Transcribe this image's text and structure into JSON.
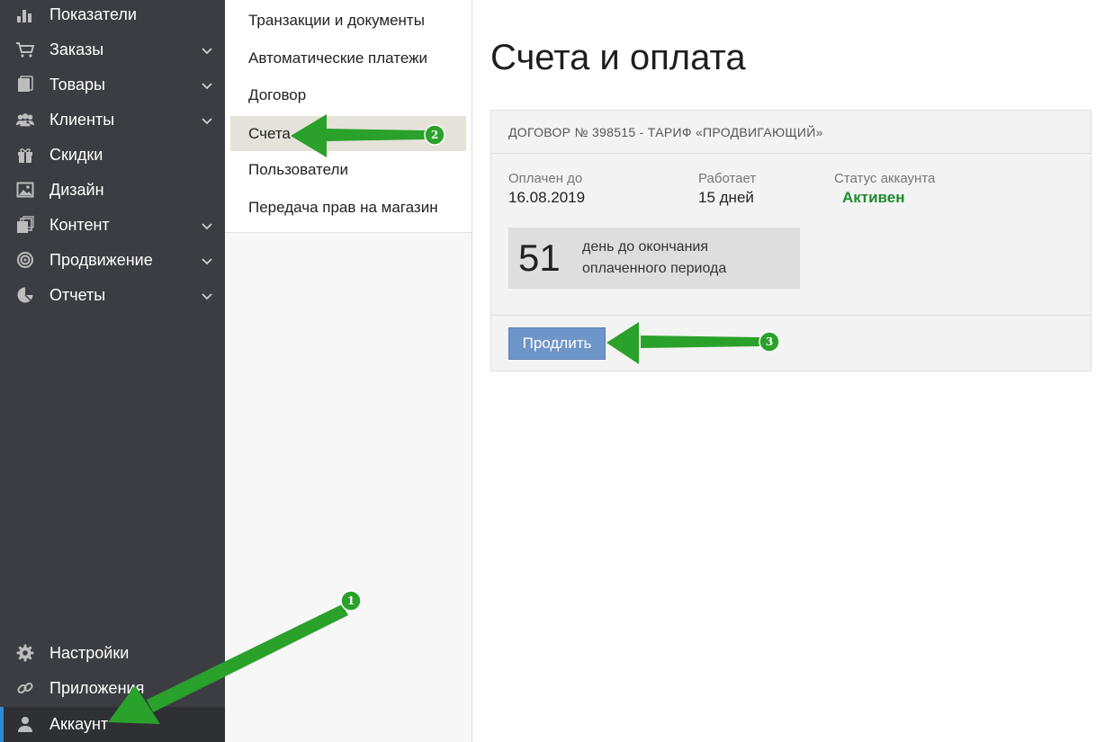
{
  "sidebar": {
    "items": [
      {
        "label": "Показатели",
        "icon": "bar-chart-icon",
        "expandable": false
      },
      {
        "label": "Заказы",
        "icon": "cart-icon",
        "expandable": true
      },
      {
        "label": "Товары",
        "icon": "products-icon",
        "expandable": true
      },
      {
        "label": "Клиенты",
        "icon": "users-icon",
        "expandable": true
      },
      {
        "label": "Скидки",
        "icon": "gift-icon",
        "expandable": false
      },
      {
        "label": "Дизайн",
        "icon": "image-icon",
        "expandable": false
      },
      {
        "label": "Контент",
        "icon": "pages-icon",
        "expandable": true
      },
      {
        "label": "Продвижение",
        "icon": "target-icon",
        "expandable": true
      },
      {
        "label": "Отчеты",
        "icon": "pie-chart-icon",
        "expandable": true
      }
    ],
    "bottom_items": [
      {
        "label": "Настройки",
        "icon": "gear-icon"
      },
      {
        "label": "Приложения",
        "icon": "link-icon"
      },
      {
        "label": "Аккаунт",
        "icon": "person-icon",
        "active": true
      }
    ],
    "accent_color": "#2e8bd0"
  },
  "submenu": {
    "items": [
      {
        "label": "Транзакции и документы"
      },
      {
        "label": "Автоматические платежи"
      },
      {
        "label": "Договор"
      },
      {
        "label": "Счета",
        "active": true
      },
      {
        "label": "Пользователи"
      },
      {
        "label": "Передача прав на магазин"
      }
    ]
  },
  "main": {
    "title": "Счета и оплата",
    "card": {
      "header": "ДОГОВОР № 398515 - ТАРИФ «ПРОДВИГАЮЩИЙ»",
      "paid_until_label": "Оплачен до",
      "paid_until_value": "16.08.2019",
      "works_label": "Работает",
      "works_value": "15 дней",
      "status_label": "Статус аккаунта",
      "status_value": "Активен",
      "days_left": "51",
      "days_text": "день до окончания оплаченного периода",
      "extend_button": "Продлить"
    }
  },
  "annotations": {
    "arrow_color": "#2aa12a",
    "badges": [
      "1",
      "2",
      "3"
    ]
  }
}
